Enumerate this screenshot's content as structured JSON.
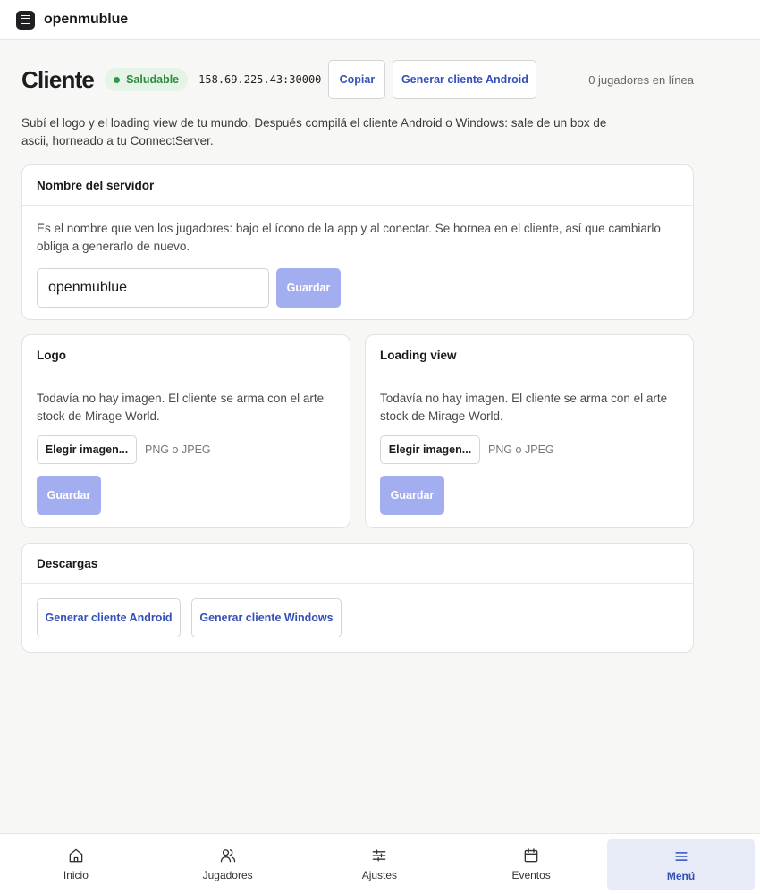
{
  "app": {
    "name": "openmublue"
  },
  "header": {
    "title": "Cliente",
    "status": "Saludable",
    "address": "158.69.225.43:30000",
    "copy_label": "Copiar",
    "android_label": "Generar cliente Android",
    "online": "0 jugadores en línea"
  },
  "intro": "Subí el logo y el loading view de tu mundo. Después compilá el cliente Android o Windows: sale de un box de ascii, horneado a tu ConnectServer.",
  "server_name": {
    "title": "Nombre del servidor",
    "description": "Es el nombre que ven los jugadores: bajo el ícono de la app y al conectar. Se hornea en el cliente, así que cambiarlo obliga a generarlo de nuevo.",
    "value": "openmublue",
    "save_label": "Guardar"
  },
  "logo": {
    "title": "Logo",
    "description": "Todavía no hay imagen. El cliente se arma con el arte stock de Mirage World.",
    "pick_label": "Elegir imagen...",
    "hint": "PNG o JPEG",
    "save_label": "Guardar"
  },
  "loading": {
    "title": "Loading view",
    "description": "Todavía no hay imagen. El cliente se arma con el arte stock de Mirage World.",
    "pick_label": "Elegir imagen...",
    "hint": "PNG o JPEG",
    "save_label": "Guardar"
  },
  "downloads": {
    "title": "Descargas",
    "android_label": "Generar cliente Android",
    "windows_label": "Generar cliente Windows"
  },
  "nav": [
    {
      "label": "Inicio",
      "icon": "home-icon"
    },
    {
      "label": "Jugadores",
      "icon": "users-icon"
    },
    {
      "label": "Ajustes",
      "icon": "sliders-icon"
    },
    {
      "label": "Eventos",
      "icon": "calendar-icon"
    },
    {
      "label": "Menú",
      "icon": "menu-icon",
      "active": true
    }
  ],
  "colors": {
    "accent": "#3450b8",
    "success": "#2d8a3e",
    "disabled_button": "#a3aef0",
    "active_nav_bg": "#e7ebf8"
  }
}
